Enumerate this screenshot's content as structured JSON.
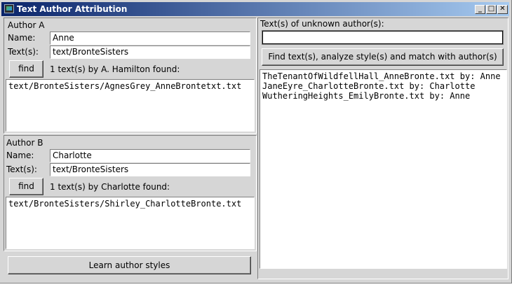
{
  "window": {
    "title": "Text Author Attribution",
    "controls": {
      "minimize": "_",
      "maximize": "□",
      "close": "✕"
    }
  },
  "author_a": {
    "heading": "Author A",
    "name_label": "Name:",
    "name_value": "Anne",
    "texts_label": "Text(s):",
    "texts_value": "text/BronteSisters",
    "find_button": "find",
    "status": "1 text(s) by A. Hamilton found:",
    "files": [
      "text/BronteSisters/AgnesGrey_AnneBrontetxt.txt"
    ]
  },
  "author_b": {
    "heading": "Author B",
    "name_label": "Name:",
    "name_value": "Charlotte",
    "texts_label": "Text(s):",
    "texts_value": "text/BronteSisters",
    "find_button": "find",
    "status": "1 text(s) by Charlotte found:",
    "files": [
      "text/BronteSisters/Shirley_CharlotteBronte.txt"
    ]
  },
  "learn_button": "Learn author styles",
  "unknown": {
    "heading": "Text(s) of unknown author(s):",
    "input_value": "",
    "analyze_button": "Find text(s), analyze style(s) and match with author(s)",
    "results": [
      "TheTenantOfWildfellHall_AnneBronte.txt by: Anne",
      "JaneEyre_CharlotteBronte.txt by: Charlotte",
      "WutheringHeights_EmilyBronte.txt by: Anne"
    ]
  },
  "icons": [
    "app-icon",
    "minimize-icon",
    "maximize-icon",
    "close-icon"
  ]
}
